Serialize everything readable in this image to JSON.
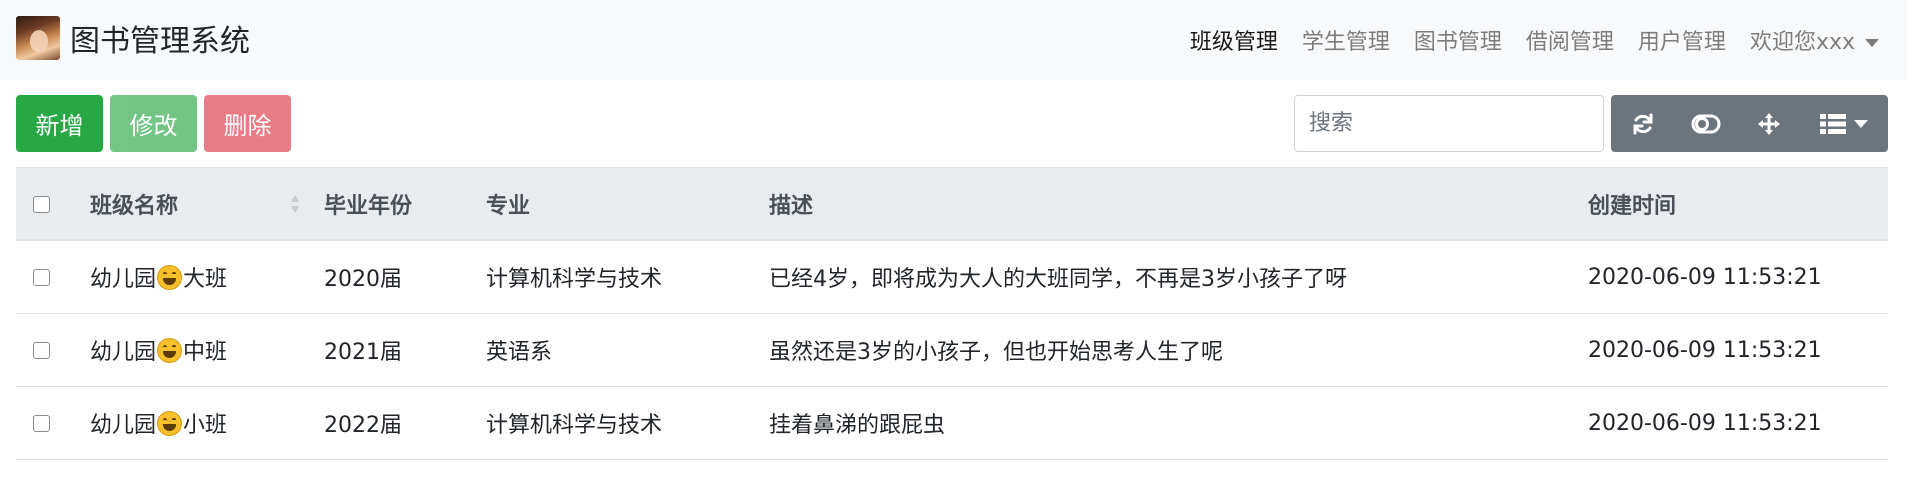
{
  "app": {
    "title": "图书管理系统",
    "logo_icon": "avatar-logo-icon"
  },
  "nav": {
    "items": [
      {
        "label": "班级管理",
        "active": true
      },
      {
        "label": "学生管理",
        "active": false
      },
      {
        "label": "图书管理",
        "active": false
      },
      {
        "label": "借阅管理",
        "active": false
      },
      {
        "label": "用户管理",
        "active": false
      }
    ],
    "user_menu": "欢迎您xxx"
  },
  "toolbar": {
    "add_label": "新增",
    "edit_label": "修改",
    "delete_label": "删除"
  },
  "search": {
    "placeholder": "搜索"
  },
  "tools": [
    "refresh-icon",
    "toggle-icon",
    "fullscreen-move-icon",
    "columns-icon"
  ],
  "table": {
    "headers": [
      "班级名称",
      "毕业年份",
      "专业",
      "描述",
      "创建时间"
    ],
    "rows": [
      {
        "name_prefix": "幼儿园",
        "name_suffix": "大班",
        "year": "2020届",
        "major": "计算机科学与技术",
        "desc": "已经4岁，即将成为大人的大班同学，不再是3岁小孩子了呀",
        "created": "2020-06-09 11:53:21"
      },
      {
        "name_prefix": "幼儿园",
        "name_suffix": "中班",
        "year": "2021届",
        "major": "英语系",
        "desc": "虽然还是3岁的小孩子，但也开始思考人生了呢",
        "created": "2020-06-09 11:53:21"
      },
      {
        "name_prefix": "幼儿园",
        "name_suffix": "小班",
        "year": "2022届",
        "major": "计算机科学与技术",
        "desc": "挂着鼻涕的跟屁虫",
        "created": "2020-06-09 11:53:21"
      }
    ]
  },
  "colors": {
    "success": "#28a745",
    "danger": "#dc3545",
    "secondary": "#6c757d",
    "header_bg": "#e9ecef"
  }
}
